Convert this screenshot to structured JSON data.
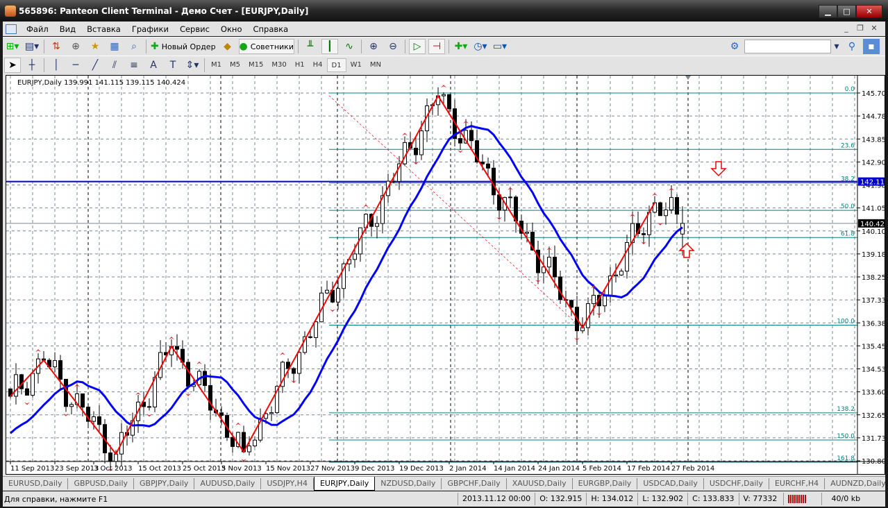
{
  "window": {
    "title": "565896: Panteon Client Terminal - Демо Счет - [EURJPY,Daily]",
    "minimize": "▁",
    "maximize": "□",
    "close": "✕"
  },
  "menu": [
    "Файл",
    "Вид",
    "Вставка",
    "Графики",
    "Сервис",
    "Окно",
    "Справка"
  ],
  "mdi": {
    "minimize": "_",
    "restore": "❐",
    "close": "✕"
  },
  "toolbar": {
    "new_order": "Новый Ордер",
    "advisors": "Советники",
    "search_placeholder": ""
  },
  "timeframes": [
    "M1",
    "M5",
    "M15",
    "M30",
    "H1",
    "H4",
    "D1",
    "W1",
    "MN"
  ],
  "active_timeframe": "D1",
  "chart_data": {
    "type": "candlestick",
    "symbol_header": "EURJPY,Daily  139.991 141.115 139.115 140.424",
    "ohlc_last": {
      "open": 139.991,
      "high": 141.115,
      "low": 139.115,
      "close": 140.424
    },
    "y_ticks": [
      "145.705",
      "144.780",
      "143.855",
      "142.905",
      "141.980",
      "141.055",
      "140.105",
      "139.180",
      "138.255",
      "137.330",
      "136.380",
      "135.455",
      "134.530",
      "133.605",
      "132.655",
      "131.730",
      "130.805"
    ],
    "ylim": [
      130.805,
      145.705
    ],
    "x_ticks": [
      {
        "i": 0,
        "label": "11 Sep 2013"
      },
      {
        "i": 8,
        "label": "23 Sep 2013"
      },
      {
        "i": 15,
        "label": "3 Oct 2013"
      },
      {
        "i": 23,
        "label": "15 Oct 2013"
      },
      {
        "i": 31,
        "label": "25 Oct 2013"
      },
      {
        "i": 38,
        "label": "5 Nov 2013"
      },
      {
        "i": 46,
        "label": "15 Nov 2013"
      },
      {
        "i": 54,
        "label": "27 Nov 2013"
      },
      {
        "i": 62,
        "label": "9 Dec 2013"
      },
      {
        "i": 70,
        "label": "19 Dec 2013"
      },
      {
        "i": 79,
        "label": "2 Jan 2014"
      },
      {
        "i": 87,
        "label": "14 Jan 2014"
      },
      {
        "i": 95,
        "label": "24 Jan 2014"
      },
      {
        "i": 103,
        "label": "5 Feb 2014"
      },
      {
        "i": 111,
        "label": "17 Feb 2014"
      },
      {
        "i": 119,
        "label": "27 Feb 2014"
      }
    ],
    "bars": 122,
    "zigzag": [
      {
        "i": 0,
        "p": 133.42
      },
      {
        "i": 6,
        "p": 134.88
      },
      {
        "i": 19,
        "p": 131.08
      },
      {
        "i": 29,
        "p": 135.44
      },
      {
        "i": 42,
        "p": 131.17
      },
      {
        "i": 77,
        "p": 145.59
      },
      {
        "i": 103,
        "p": 136.2
      },
      {
        "i": 116,
        "p": 141.26
      },
      {
        "i": 121,
        "p": 140.424
      }
    ],
    "ma_period": 13,
    "fib_levels": [
      {
        "label": "0.0",
        "p": 145.705
      },
      {
        "label": "23.6",
        "p": 143.42
      },
      {
        "label": "38.2",
        "p": 142.06
      },
      {
        "label": "50.0",
        "p": 140.95
      },
      {
        "label": "61.8",
        "p": 139.85
      },
      {
        "label": "100.0",
        "p": 136.3
      },
      {
        "label": "138.2",
        "p": 132.75
      },
      {
        "label": "150.0",
        "p": 131.65
      },
      {
        "label": "161.8",
        "p": 130.75
      }
    ],
    "hline_blue": "142.117",
    "current_price": "140.424",
    "colors": {
      "zigzag": "#ff0000",
      "ma": "#0000ff",
      "fib": "#008080",
      "bull": "#ffffff",
      "bear": "#000000"
    }
  },
  "tabs": [
    "EURUSD,Daily",
    "GBPUSD,Daily",
    "GBPJPY,Daily",
    "AUDUSD,Daily",
    "USDJPY,H4",
    "EURJPY,Daily",
    "NZDUSD,Daily",
    "GBPCHF,Daily",
    "XAUUSD,Daily",
    "EURGBP,Daily",
    "USDCAD,Daily",
    "USDCHF,Daily",
    "EURCHF,H4",
    "AUDNZD,Daily"
  ],
  "active_tab": "EURJPY,Daily",
  "status": {
    "help": "Для справки, нажмите F1",
    "time": "2013.11.12 00:00",
    "open": "O: 132.915",
    "high": "H: 134.012",
    "low": "L: 132.902",
    "close": "C: 133.833",
    "volume": "V: 77332",
    "traffic": "40/0 kb"
  }
}
